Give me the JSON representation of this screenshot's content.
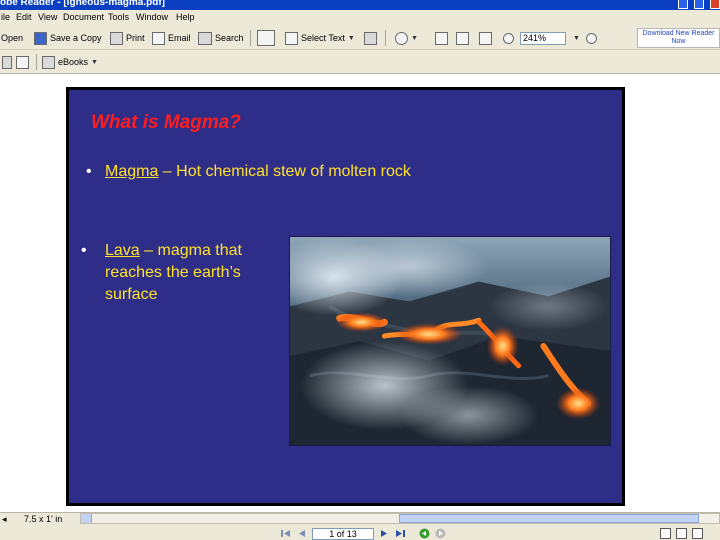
{
  "window": {
    "title": "obe Reader - [igneous-magma.pdf]"
  },
  "menu": [
    "ile",
    "Edit",
    "View",
    "Document",
    "Tools",
    "Window",
    "Help"
  ],
  "toolbar": {
    "open_label": "Open",
    "save_copy_label": "Save a Copy",
    "print_label": "Print",
    "email_label": "Email",
    "search_label": "Search",
    "select_text_label": "Select Text",
    "zoom_value": "241%",
    "ebooks_label": "eBooks",
    "download_banner": "Download New Reader Now"
  },
  "slide": {
    "title": "What is Magma?",
    "bullet1": {
      "term": "Magma",
      "text": " – Hot chemical stew of molten rock"
    },
    "bullet2": {
      "term": "Lava",
      "text1": " – magma that",
      "text2": "reaches the earth’s",
      "text3": "surface"
    },
    "photo": "lava-flow-photo"
  },
  "status": {
    "page_size": "7.5 x 1' in",
    "page_indicator": "1 of 13"
  },
  "colors": {
    "slide_bg": "#2e2e88",
    "title_red": "#ff1c1c",
    "text_yellow": "#ffe12b"
  }
}
